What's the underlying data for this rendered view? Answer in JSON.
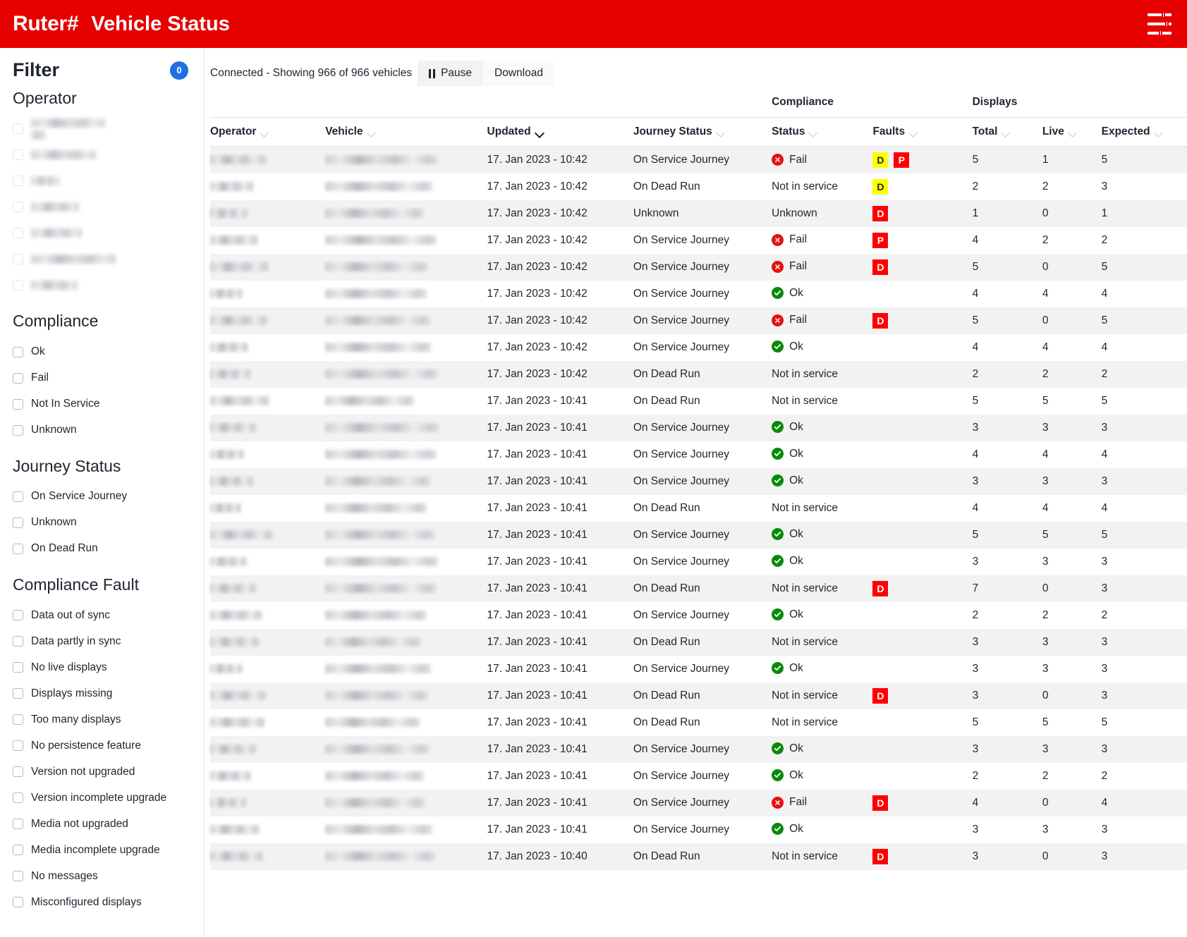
{
  "topbar": {
    "brand": "Ruter#",
    "title": "Vehicle Status",
    "settings_icon": "tune-icon"
  },
  "sidebar": {
    "title": "Filter",
    "badge_count": "0",
    "sections": [
      {
        "title": "Operator",
        "redacted": true,
        "items": [
          {
            "label": "",
            "widths": [
              105,
              42
            ]
          },
          {
            "label": "",
            "widths": [
              92
            ]
          },
          {
            "label": "",
            "widths": [
              40
            ]
          },
          {
            "label": "",
            "widths": [
              68
            ]
          },
          {
            "label": "",
            "widths": [
              72
            ]
          },
          {
            "label": "",
            "widths": [
              120
            ]
          },
          {
            "label": "",
            "widths": [
              66
            ]
          }
        ]
      },
      {
        "title": "Compliance",
        "redacted": false,
        "items": [
          {
            "label": "Ok"
          },
          {
            "label": "Fail"
          },
          {
            "label": "Not In Service"
          },
          {
            "label": "Unknown"
          }
        ]
      },
      {
        "title": "Journey Status",
        "redacted": false,
        "items": [
          {
            "label": "On Service Journey"
          },
          {
            "label": "Unknown"
          },
          {
            "label": "On Dead Run"
          }
        ]
      },
      {
        "title": "Compliance Fault",
        "redacted": false,
        "items": [
          {
            "label": "Data out of sync"
          },
          {
            "label": "Data partly in sync"
          },
          {
            "label": "No live displays"
          },
          {
            "label": "Displays missing"
          },
          {
            "label": "Too many displays"
          },
          {
            "label": "No persistence feature"
          },
          {
            "label": "Version not upgraded"
          },
          {
            "label": "Version incomplete upgrade"
          },
          {
            "label": "Media not upgraded"
          },
          {
            "label": "Media incomplete upgrade"
          },
          {
            "label": "No messages"
          },
          {
            "label": "Misconfigured displays"
          }
        ]
      }
    ]
  },
  "toolbar": {
    "status_text": "Connected - Showing 966 of 966 vehicles",
    "pause_label": "Pause",
    "download_label": "Download"
  },
  "table": {
    "group_headers": [
      {
        "label": "Compliance",
        "span": 2
      },
      {
        "label": "Displays",
        "span": 3
      }
    ],
    "columns": [
      {
        "key": "operator",
        "label": "Operator",
        "sorted": false
      },
      {
        "key": "vehicle",
        "label": "Vehicle",
        "sorted": false
      },
      {
        "key": "updated",
        "label": "Updated",
        "sorted": true
      },
      {
        "key": "journey_status",
        "label": "Journey Status",
        "sorted": false
      },
      {
        "key": "status",
        "label": "Status",
        "sorted": false
      },
      {
        "key": "faults",
        "label": "Faults",
        "sorted": false
      },
      {
        "key": "total",
        "label": "Total",
        "sorted": false
      },
      {
        "key": "live",
        "label": "Live",
        "sorted": false
      },
      {
        "key": "expected",
        "label": "Expected",
        "sorted": false
      }
    ],
    "rows": [
      {
        "op_w": 80,
        "veh_w": 160,
        "updated": "17. Jan 2023 - 10:42",
        "journey_status": "On Service Journey",
        "status": "Fail",
        "status_icon": "fail",
        "faults": [
          {
            "code": "D",
            "color": "yellow"
          },
          {
            "code": "P",
            "color": "red"
          }
        ],
        "total": "5",
        "live": "1",
        "expected": "5"
      },
      {
        "op_w": 62,
        "veh_w": 152,
        "updated": "17. Jan 2023 - 10:42",
        "journey_status": "On Dead Run",
        "status": "Not in service",
        "status_icon": "none",
        "faults": [
          {
            "code": "D",
            "color": "yellow"
          }
        ],
        "total": "2",
        "live": "2",
        "expected": "3"
      },
      {
        "op_w": 54,
        "veh_w": 140,
        "updated": "17. Jan 2023 - 10:42",
        "journey_status": "Unknown",
        "status": "Unknown",
        "status_icon": "none",
        "faults": [
          {
            "code": "D",
            "color": "red"
          }
        ],
        "total": "1",
        "live": "0",
        "expected": "1"
      },
      {
        "op_w": 68,
        "veh_w": 158,
        "updated": "17. Jan 2023 - 10:42",
        "journey_status": "On Service Journey",
        "status": "Fail",
        "status_icon": "fail",
        "faults": [
          {
            "code": "P",
            "color": "red"
          }
        ],
        "total": "4",
        "live": "2",
        "expected": "2"
      },
      {
        "op_w": 84,
        "veh_w": 146,
        "updated": "17. Jan 2023 - 10:42",
        "journey_status": "On Service Journey",
        "status": "Fail",
        "status_icon": "fail",
        "faults": [
          {
            "code": "D",
            "color": "red"
          }
        ],
        "total": "5",
        "live": "0",
        "expected": "5"
      },
      {
        "op_w": 46,
        "veh_w": 144,
        "updated": "17. Jan 2023 - 10:42",
        "journey_status": "On Service Journey",
        "status": "Ok",
        "status_icon": "ok",
        "faults": [],
        "total": "4",
        "live": "4",
        "expected": "4"
      },
      {
        "op_w": 82,
        "veh_w": 150,
        "updated": "17. Jan 2023 - 10:42",
        "journey_status": "On Service Journey",
        "status": "Fail",
        "status_icon": "fail",
        "faults": [
          {
            "code": "D",
            "color": "red"
          }
        ],
        "total": "5",
        "live": "0",
        "expected": "5"
      },
      {
        "op_w": 54,
        "veh_w": 150,
        "updated": "17. Jan 2023 - 10:42",
        "journey_status": "On Service Journey",
        "status": "Ok",
        "status_icon": "ok",
        "faults": [],
        "total": "4",
        "live": "4",
        "expected": "4"
      },
      {
        "op_w": 58,
        "veh_w": 160,
        "updated": "17. Jan 2023 - 10:42",
        "journey_status": "On Dead Run",
        "status": "Not in service",
        "status_icon": "none",
        "faults": [],
        "total": "2",
        "live": "2",
        "expected": "2"
      },
      {
        "op_w": 84,
        "veh_w": 126,
        "updated": "17. Jan 2023 - 10:41",
        "journey_status": "On Dead Run",
        "status": "Not in service",
        "status_icon": "none",
        "faults": [],
        "total": "5",
        "live": "5",
        "expected": "5"
      },
      {
        "op_w": 66,
        "veh_w": 162,
        "updated": "17. Jan 2023 - 10:41",
        "journey_status": "On Service Journey",
        "status": "Ok",
        "status_icon": "ok",
        "faults": [],
        "total": "3",
        "live": "3",
        "expected": "3"
      },
      {
        "op_w": 48,
        "veh_w": 158,
        "updated": "17. Jan 2023 - 10:41",
        "journey_status": "On Service Journey",
        "status": "Ok",
        "status_icon": "ok",
        "faults": [],
        "total": "4",
        "live": "4",
        "expected": "4"
      },
      {
        "op_w": 62,
        "veh_w": 150,
        "updated": "17. Jan 2023 - 10:41",
        "journey_status": "On Service Journey",
        "status": "Ok",
        "status_icon": "ok",
        "faults": [],
        "total": "3",
        "live": "3",
        "expected": "3"
      },
      {
        "op_w": 44,
        "veh_w": 144,
        "updated": "17. Jan 2023 - 10:41",
        "journey_status": "On Dead Run",
        "status": "Not in service",
        "status_icon": "none",
        "faults": [],
        "total": "4",
        "live": "4",
        "expected": "4"
      },
      {
        "op_w": 90,
        "veh_w": 156,
        "updated": "17. Jan 2023 - 10:41",
        "journey_status": "On Service Journey",
        "status": "Ok",
        "status_icon": "ok",
        "faults": [],
        "total": "5",
        "live": "5",
        "expected": "5"
      },
      {
        "op_w": 52,
        "veh_w": 160,
        "updated": "17. Jan 2023 - 10:41",
        "journey_status": "On Service Journey",
        "status": "Ok",
        "status_icon": "ok",
        "faults": [],
        "total": "3",
        "live": "3",
        "expected": "3"
      },
      {
        "op_w": 66,
        "veh_w": 158,
        "updated": "17. Jan 2023 - 10:41",
        "journey_status": "On Dead Run",
        "status": "Not in service",
        "status_icon": "none",
        "faults": [
          {
            "code": "D",
            "color": "red"
          }
        ],
        "total": "7",
        "live": "0",
        "expected": "3"
      },
      {
        "op_w": 74,
        "veh_w": 144,
        "updated": "17. Jan 2023 - 10:41",
        "journey_status": "On Service Journey",
        "status": "Ok",
        "status_icon": "ok",
        "faults": [],
        "total": "2",
        "live": "2",
        "expected": "2"
      },
      {
        "op_w": 70,
        "veh_w": 136,
        "updated": "17. Jan 2023 - 10:41",
        "journey_status": "On Dead Run",
        "status": "Not in service",
        "status_icon": "none",
        "faults": [],
        "total": "3",
        "live": "3",
        "expected": "3"
      },
      {
        "op_w": 46,
        "veh_w": 150,
        "updated": "17. Jan 2023 - 10:41",
        "journey_status": "On Service Journey",
        "status": "Ok",
        "status_icon": "ok",
        "faults": [],
        "total": "3",
        "live": "3",
        "expected": "3"
      },
      {
        "op_w": 80,
        "veh_w": 146,
        "updated": "17. Jan 2023 - 10:41",
        "journey_status": "On Dead Run",
        "status": "Not in service",
        "status_icon": "none",
        "faults": [
          {
            "code": "D",
            "color": "red"
          }
        ],
        "total": "3",
        "live": "0",
        "expected": "3"
      },
      {
        "op_w": 78,
        "veh_w": 134,
        "updated": "17. Jan 2023 - 10:41",
        "journey_status": "On Dead Run",
        "status": "Not in service",
        "status_icon": "none",
        "faults": [],
        "total": "5",
        "live": "5",
        "expected": "5"
      },
      {
        "op_w": 66,
        "veh_w": 148,
        "updated": "17. Jan 2023 - 10:41",
        "journey_status": "On Service Journey",
        "status": "Ok",
        "status_icon": "ok",
        "faults": [],
        "total": "3",
        "live": "3",
        "expected": "3"
      },
      {
        "op_w": 58,
        "veh_w": 140,
        "updated": "17. Jan 2023 - 10:41",
        "journey_status": "On Service Journey",
        "status": "Ok",
        "status_icon": "ok",
        "faults": [],
        "total": "2",
        "live": "2",
        "expected": "2"
      },
      {
        "op_w": 52,
        "veh_w": 142,
        "updated": "17. Jan 2023 - 10:41",
        "journey_status": "On Service Journey",
        "status": "Fail",
        "status_icon": "fail",
        "faults": [
          {
            "code": "D",
            "color": "red"
          }
        ],
        "total": "4",
        "live": "0",
        "expected": "4"
      },
      {
        "op_w": 70,
        "veh_w": 152,
        "updated": "17. Jan 2023 - 10:41",
        "journey_status": "On Service Journey",
        "status": "Ok",
        "status_icon": "ok",
        "faults": [],
        "total": "3",
        "live": "3",
        "expected": "3"
      },
      {
        "op_w": 76,
        "veh_w": 156,
        "updated": "17. Jan 2023 - 10:40",
        "journey_status": "On Dead Run",
        "status": "Not in service",
        "status_icon": "none",
        "faults": [
          {
            "code": "D",
            "color": "red"
          }
        ],
        "total": "3",
        "live": "0",
        "expected": "3"
      }
    ]
  },
  "colors": {
    "brand_red": "#e60000",
    "badge_blue": "#1f6fe5",
    "ok_green": "#0a8a0a",
    "fail_red": "#e81010",
    "chip_yellow": "#ffff00",
    "chip_red": "#ff0000"
  }
}
